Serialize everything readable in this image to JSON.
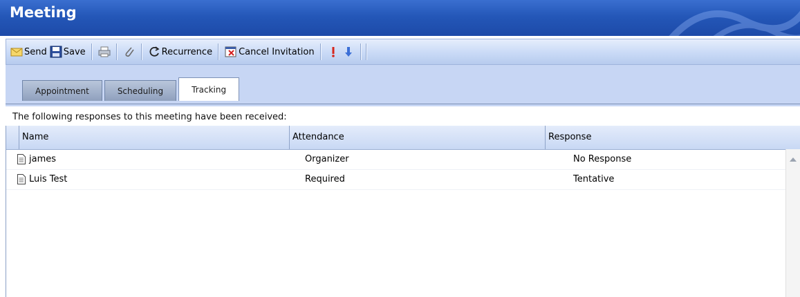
{
  "window": {
    "title": "Meeting"
  },
  "toolbar": {
    "send_label": "Send",
    "save_label": "Save",
    "recurrence_label": "Recurrence",
    "cancel_label": "Cancel Invitation"
  },
  "tabs": [
    {
      "label": "Appointment"
    },
    {
      "label": "Scheduling"
    },
    {
      "label": "Tracking"
    }
  ],
  "tracking": {
    "message": "The following responses to this meeting have been received:",
    "columns": [
      "Name",
      "Attendance",
      "Response"
    ],
    "rows": [
      {
        "name": "james",
        "attendance": "Organizer",
        "response": "No Response"
      },
      {
        "name": "Luis Test",
        "attendance": "Required",
        "response": "Tentative"
      }
    ]
  },
  "colors": {
    "title_bar": "#2457b8",
    "toolbar": "#c9daf6",
    "tab_area": "#c7d6f4"
  },
  "icons": [
    "envelope-icon",
    "floppy-icon",
    "printer-icon",
    "paperclip-icon",
    "recurrence-icon",
    "cancel-invitation-icon",
    "high-importance-icon",
    "low-importance-icon",
    "document-icon"
  ]
}
